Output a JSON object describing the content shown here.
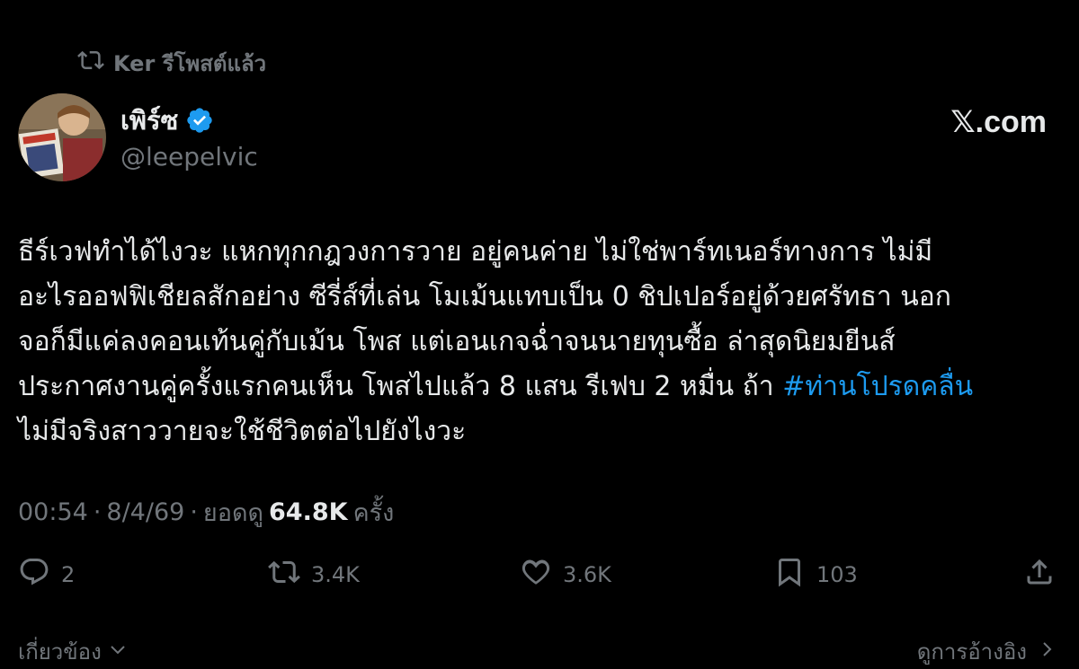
{
  "repost": {
    "label": "Ker รีโพสต์แล้ว",
    "icon": "repost-icon"
  },
  "author": {
    "display_name": "เพิร์ซ",
    "handle": "@leepelvic",
    "verified": true,
    "avatar_icon": "avatar"
  },
  "site_label": "𝕏.com",
  "tweet": {
    "lines": [
      "ธีร์เวฟทำได้ไงวะ แหกทุกกฎวงการวาย อยู่คนค่าย ไม่ใช่พาร์ทเนอร์ทางการ ไม่มี",
      "อะไรออฟฟิเชียลสักอย่าง ซีรี่ส์ที่เล่น โมเม้นแทบเป็น 0 ชิปเปอร์อยู่ด้วยศรัทธา นอก",
      "จอก็มีแค่ลงคอนเท้นคู่กับเม้น โพส แต่เอนเกจฉ่ำจนนายทุนซื้อ ล่าสุดนิยมยีนส์",
      "ประกาศงานคู่ครั้งแรกคนเห็น โพสไปแล้ว 8 แสน รีเฟบ 2 หมื่น ถ้า ",
      "ไม่มีจริงสาววายจะใช้ชีวิตต่อไปยังไงวะ"
    ],
    "hashtag": "#ท่านโปรดคลื่น",
    "hashtag_color": "#1d9bf0"
  },
  "meta": {
    "time": "00:54",
    "date": "8/4/69",
    "views_label": "ยอดดู",
    "views": "64.8K",
    "views_suffix": "ครั้ง",
    "sep1": "·",
    "sep2": "·"
  },
  "actions": {
    "reply": {
      "count": "2",
      "icon": "reply-icon"
    },
    "repost": {
      "count": "3.4K",
      "icon": "repost-icon"
    },
    "like": {
      "count": "3.6K",
      "icon": "heart-icon"
    },
    "bookmark": {
      "count": "103",
      "icon": "bookmark-icon"
    },
    "share": {
      "icon": "share-icon"
    }
  },
  "footer": {
    "related": "เกี่ยวข้อง",
    "quotes": "ดูการอ้างอิง"
  },
  "colors": {
    "background": "#000000",
    "text": "#e7e9ea",
    "muted": "#71767b",
    "accent": "#1d9bf0"
  }
}
